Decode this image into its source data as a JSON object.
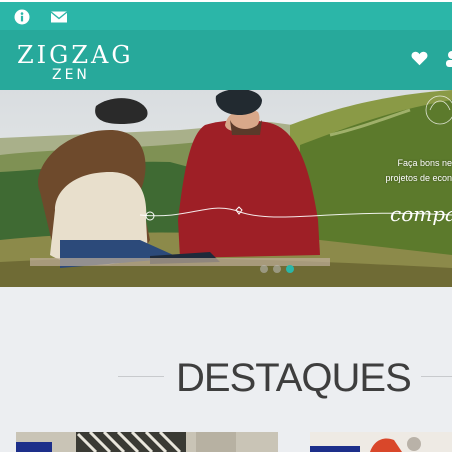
{
  "topbar": {
    "info_icon": "info-icon",
    "mail_icon": "mail-icon"
  },
  "header": {
    "logo_line1": "ZIGZAG",
    "logo_line2": "ZEN",
    "heart_icon": "heart-icon"
  },
  "hero": {
    "text_line1": "Faça bons ne",
    "text_line2": "projetos de econ",
    "script_text": "compa",
    "slides": 3,
    "active_slide": 2
  },
  "section": {
    "title": "DESTAQUES"
  },
  "colors": {
    "teal_light": "#2bb6a8",
    "teal_dark": "#27a99b",
    "background": "#eceef1"
  }
}
